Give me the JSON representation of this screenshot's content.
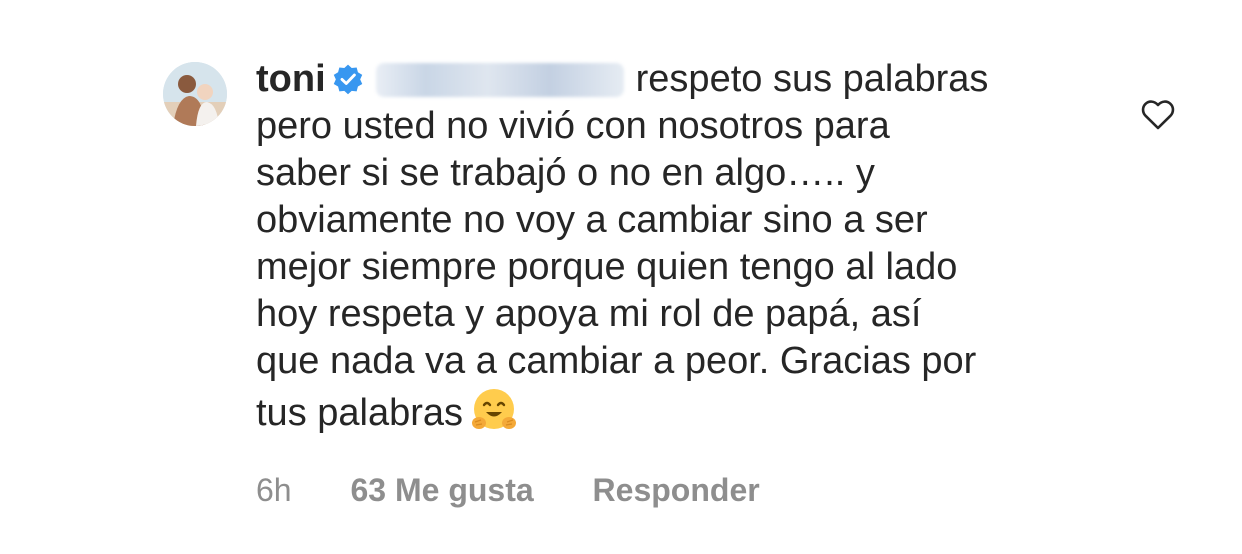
{
  "comment": {
    "username": "toni",
    "text_lines": [
      "respeto sus palabras",
      "pero usted no vivió con nosotros para",
      "saber si se trabajó o no en algo….. y",
      "obviamente no voy a cambiar sino a ser",
      "mejor siempre porque quien tengo al lado",
      "hoy respeta y apoya mi rol de papá, así",
      "que nada va a cambiar a peor. Gracias por",
      "tus palabras"
    ],
    "emoji": "hugging-face-emoji",
    "time": "6h",
    "likes": "63 Me gusta",
    "reply": "Responder"
  },
  "icons": {
    "verified": "verified-badge-icon",
    "like": "heart-outline-icon"
  },
  "colors": {
    "text": "#262626",
    "secondary": "#8e8e8e",
    "verified_blue": "#3897f0"
  }
}
